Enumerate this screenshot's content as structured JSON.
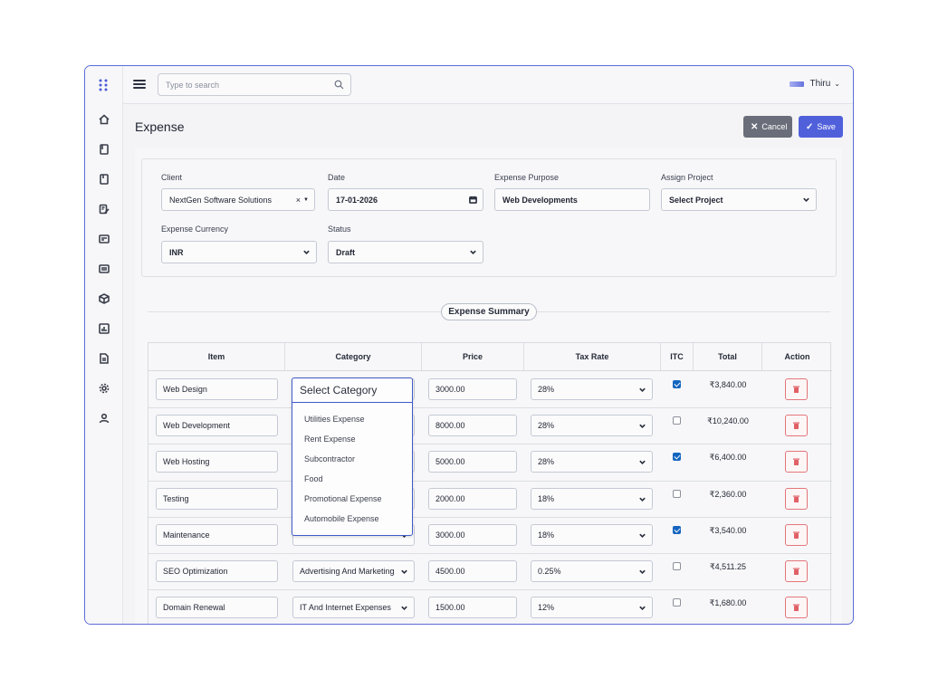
{
  "user": {
    "name": "Thiru"
  },
  "search": {
    "placeholder": "Type to search"
  },
  "page": {
    "title": "Expense"
  },
  "actions": {
    "cancel_label": "Cancel",
    "save_label": "Save"
  },
  "form": {
    "client": {
      "label": "Client",
      "value": "NextGen Software Solutions"
    },
    "date": {
      "label": "Date",
      "value": "17-01-2026"
    },
    "purpose": {
      "label": "Expense Purpose",
      "value": "Web Developments"
    },
    "project": {
      "label": "Assign Project",
      "value": "Select Project"
    },
    "currency": {
      "label": "Expense Currency",
      "value": "INR"
    },
    "status": {
      "label": "Status",
      "value": "Draft"
    }
  },
  "summary": {
    "title": "Expense Summary"
  },
  "table": {
    "headers": [
      "Item",
      "Category",
      "Price",
      "Tax Rate",
      "ITC",
      "Total",
      "Action"
    ],
    "rows": [
      {
        "item": "Web Design",
        "category": "",
        "price": "3000.00",
        "tax": "28%",
        "itc": true,
        "total": "₹3,840.00"
      },
      {
        "item": "Web Development",
        "category": "",
        "price": "8000.00",
        "tax": "28%",
        "itc": false,
        "total": "₹10,240.00"
      },
      {
        "item": "Web Hosting",
        "category": "",
        "price": "5000.00",
        "tax": "28%",
        "itc": true,
        "total": "₹6,400.00"
      },
      {
        "item": "Testing",
        "category": "",
        "price": "2000.00",
        "tax": "18%",
        "itc": false,
        "total": "₹2,360.00"
      },
      {
        "item": "Maintenance",
        "category": "",
        "price": "3000.00",
        "tax": "18%",
        "itc": true,
        "total": "₹3,540.00"
      },
      {
        "item": "SEO Optimization",
        "category": "Advertising And Marketing",
        "price": "4500.00",
        "tax": "0.25%",
        "itc": false,
        "total": "₹4,511.25"
      },
      {
        "item": "Domain Renewal",
        "category": "IT And Internet Expenses",
        "price": "1500.00",
        "tax": "12%",
        "itc": false,
        "total": "₹1,680.00"
      }
    ]
  },
  "category_dropdown": {
    "placeholder": "Select Category",
    "options": [
      "Utilities Expense",
      "Rent Expense",
      "Subcontractor",
      "Food",
      "Promotional Expense",
      "Automobile Expense"
    ]
  },
  "colors": {
    "accent": "#5060db",
    "cancel": "#6a6e7a",
    "delete": "#e06066",
    "frame": "#5b6cd8"
  },
  "icons": {
    "sidebar": [
      "home-icon",
      "book-icon",
      "bookmark-icon",
      "edit-note-icon",
      "card-icon",
      "list-card-icon",
      "box-icon",
      "chart-icon",
      "document-icon",
      "gear-icon",
      "user-icon"
    ]
  }
}
